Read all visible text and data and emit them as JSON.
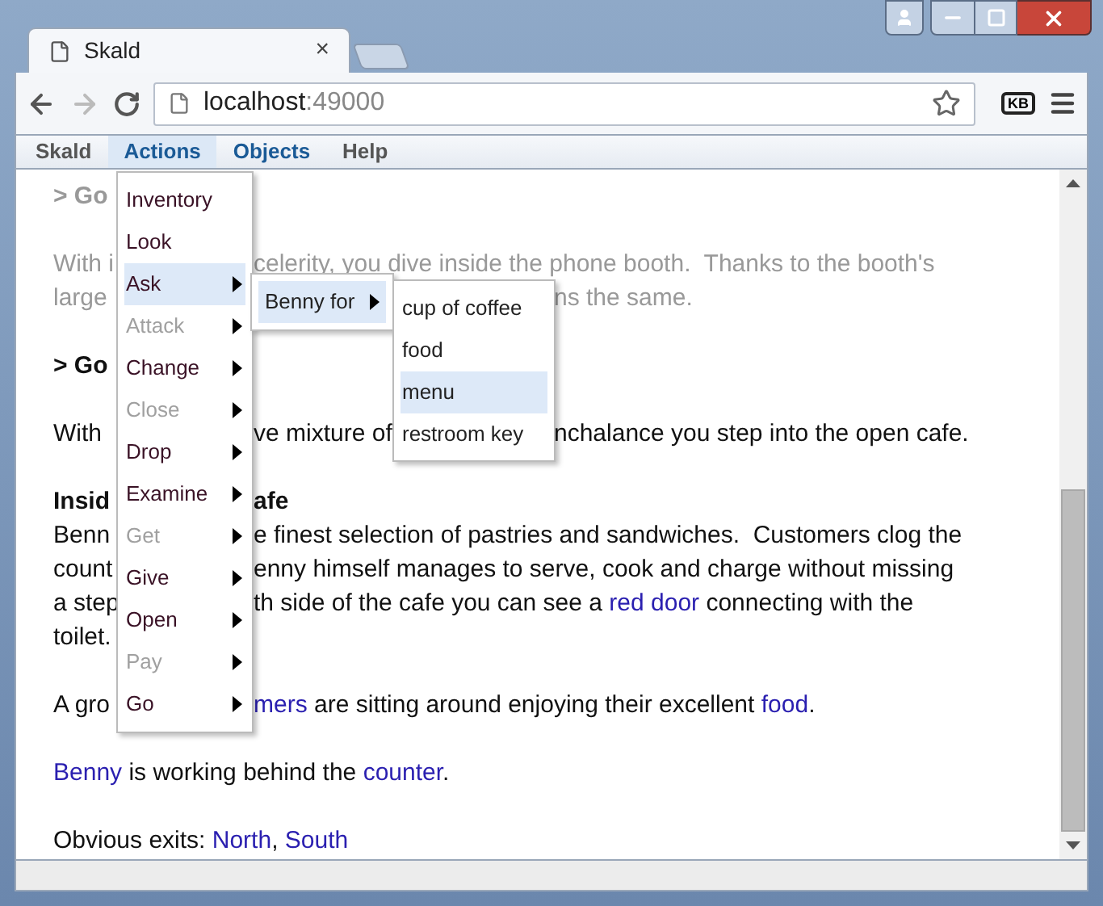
{
  "browser": {
    "tab": {
      "title": "Skald",
      "close": "×"
    },
    "address": {
      "host": "localhost",
      "port": ":49000"
    },
    "extension": "KB",
    "forward_disabled": true
  },
  "menubar": [
    {
      "label": "Skald",
      "selected": false,
      "color": "#555555"
    },
    {
      "label": "Actions",
      "selected": true,
      "color": "#1a5a96"
    },
    {
      "label": "Objects",
      "selected": false,
      "color": "#1a5a96"
    },
    {
      "label": "Help",
      "selected": false,
      "color": "#555555"
    }
  ],
  "story": [
    {
      "faded": true,
      "lines": [
        {
          "bold": true,
          "left": [
            {
              "kind": "text",
              "text": "> Go"
            }
          ]
        }
      ]
    },
    {
      "faded": true,
      "lines": [
        {
          "bold": false,
          "left": [
            {
              "kind": "text",
              "text": "With i"
            }
          ],
          "after_menu": [
            {
              "kind": "text",
              "text": "celerity, you dive inside the phone booth.  Thanks to the booth's"
            }
          ]
        },
        {
          "bold": false,
          "left": [
            {
              "kind": "text",
              "text": "large"
            }
          ],
          "after_submenu": [
            {
              "kind": "text",
              "text": "ns the same."
            }
          ]
        }
      ]
    },
    {
      "faded": false,
      "lines": [
        {
          "bold": true,
          "left": [
            {
              "kind": "text",
              "text": "> Go"
            }
          ]
        }
      ]
    },
    {
      "faded": false,
      "lines": [
        {
          "bold": false,
          "left": [
            {
              "kind": "text",
              "text": "With"
            }
          ],
          "after_menu": [
            {
              "kind": "text",
              "text": "ve mixture of"
            }
          ],
          "after_submenu": [
            {
              "kind": "text",
              "text": "nchalance you step into the open cafe."
            }
          ]
        }
      ]
    },
    {
      "faded": false,
      "lines": [
        {
          "bold": true,
          "left": [
            {
              "kind": "text",
              "text": "Insid"
            }
          ],
          "after_menu": [
            {
              "kind": "text",
              "text": "afe"
            }
          ]
        },
        {
          "bold": false,
          "left": [
            {
              "kind": "text",
              "text": "Benn"
            }
          ],
          "after_menu": [
            {
              "kind": "text",
              "text": "e finest selection of pastries and sandwiches.  Customers clog the"
            }
          ]
        },
        {
          "bold": false,
          "left": [
            {
              "kind": "text",
              "text": "count"
            }
          ],
          "after_menu": [
            {
              "kind": "text",
              "text": "enny himself manages to serve, cook and charge without missing"
            }
          ]
        },
        {
          "bold": false,
          "left": [
            {
              "kind": "text",
              "text": "a step"
            }
          ],
          "after_menu": [
            {
              "kind": "text",
              "text": "th side of the cafe you can see a "
            },
            {
              "kind": "link",
              "text": "red door"
            },
            {
              "kind": "text",
              "text": " connecting with the"
            }
          ]
        },
        {
          "bold": false,
          "left": [
            {
              "kind": "text",
              "text": "toilet."
            }
          ]
        }
      ]
    },
    {
      "faded": false,
      "lines": [
        {
          "bold": false,
          "left": [
            {
              "kind": "text",
              "text": "A gro"
            }
          ],
          "after_menu": [
            {
              "kind": "link",
              "text": "mers"
            },
            {
              "kind": "text",
              "text": " are sitting around enjoying their excellent "
            },
            {
              "kind": "link",
              "text": "food"
            },
            {
              "kind": "text",
              "text": "."
            }
          ]
        }
      ]
    },
    {
      "faded": false,
      "lines": [
        {
          "bold": false,
          "full": [
            {
              "kind": "link",
              "text": "Benny"
            },
            {
              "kind": "text",
              "text": " is working behind the "
            },
            {
              "kind": "link",
              "text": "counter"
            },
            {
              "kind": "text",
              "text": "."
            }
          ]
        }
      ]
    },
    {
      "faded": false,
      "lines": [
        {
          "bold": false,
          "full": [
            {
              "kind": "text",
              "text": "Obvious exits: "
            },
            {
              "kind": "link",
              "text": "North"
            },
            {
              "kind": "text",
              "text": ", "
            },
            {
              "kind": "link",
              "text": "South"
            }
          ]
        }
      ]
    }
  ],
  "actions_menu": [
    {
      "label": "Inventory",
      "disabled": false,
      "submenu": false,
      "selected": false
    },
    {
      "label": "Look",
      "disabled": false,
      "submenu": false,
      "selected": false
    },
    {
      "label": "Ask",
      "disabled": false,
      "submenu": true,
      "selected": true
    },
    {
      "label": "Attack",
      "disabled": true,
      "submenu": true,
      "selected": false
    },
    {
      "label": "Change",
      "disabled": false,
      "submenu": true,
      "selected": false
    },
    {
      "label": "Close",
      "disabled": true,
      "submenu": true,
      "selected": false
    },
    {
      "label": "Drop",
      "disabled": false,
      "submenu": true,
      "selected": false
    },
    {
      "label": "Examine",
      "disabled": false,
      "submenu": true,
      "selected": false
    },
    {
      "label": "Get",
      "disabled": true,
      "submenu": true,
      "selected": false
    },
    {
      "label": "Give",
      "disabled": false,
      "submenu": true,
      "selected": false
    },
    {
      "label": "Open",
      "disabled": false,
      "submenu": true,
      "selected": false
    },
    {
      "label": "Pay",
      "disabled": true,
      "submenu": true,
      "selected": false
    },
    {
      "label": "Go",
      "disabled": false,
      "submenu": true,
      "selected": false
    }
  ],
  "ask_menu": [
    {
      "label": "Benny for",
      "submenu": true,
      "selected": true
    }
  ],
  "benny_menu": [
    {
      "label": "cup of coffee",
      "selected": false
    },
    {
      "label": "food",
      "selected": false
    },
    {
      "label": "menu",
      "selected": true
    },
    {
      "label": "restroom key",
      "selected": false
    }
  ]
}
